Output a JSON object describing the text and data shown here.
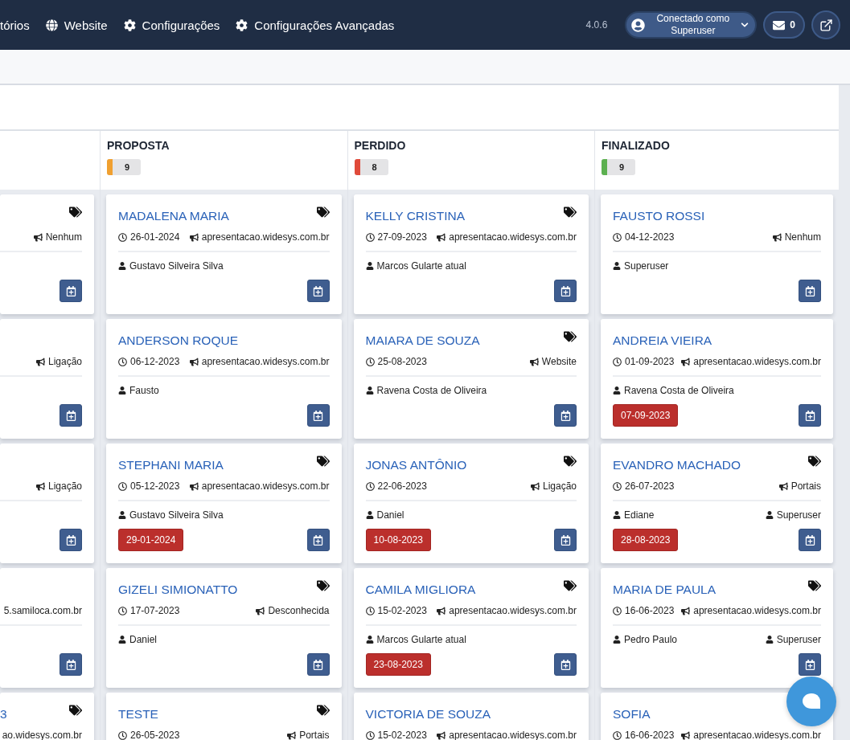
{
  "navbar": {
    "items": [
      {
        "label": "tórios"
      },
      {
        "label": "Website"
      },
      {
        "label": "Configurações"
      },
      {
        "label": "Configurações Avançadas"
      }
    ],
    "version": "4.0.6",
    "user": {
      "line1": "Conectado como",
      "line2": "Superuser"
    },
    "messages": "0"
  },
  "columns": [
    {
      "partial": true,
      "cards": [
        {
          "tagged": true,
          "source": "Nenhum",
          "cut": false
        },
        {
          "tagged": false,
          "source": "Ligação",
          "cut": false
        },
        {
          "tagged": false,
          "source": "Ligação",
          "cut": false
        },
        {
          "tagged": false,
          "source": "5.samiloca.com.br",
          "cut": true
        },
        {
          "tagged": true,
          "name": "3",
          "source": "ao.widesys.com.br",
          "cut": true
        }
      ]
    },
    {
      "partial": false,
      "title": "PROPOSTA",
      "count": "9",
      "color": "#f0a030",
      "cards": [
        {
          "name": "MADALENA MARIA",
          "tagged": true,
          "date": "26-01-2024",
          "source": "apresentacao.widesys.com.br",
          "owner": "Gustavo Silveira Silva"
        },
        {
          "name": "ANDERSON ROQUE",
          "tagged": false,
          "date": "06-12-2023",
          "source": "apresentacao.widesys.com.br",
          "owner": "Fausto"
        },
        {
          "name": "STEPHANI MARIA",
          "tagged": true,
          "date": "05-12-2023",
          "source": "apresentacao.widesys.com.br",
          "owner": "Gustavo Silveira Silva",
          "due": "29-01-2024"
        },
        {
          "name": "GIZELI SIMIONATTO",
          "tagged": true,
          "date": "17-07-2023",
          "source": "Desconhecida",
          "owner": "Daniel"
        },
        {
          "name": "TESTE",
          "tagged": true,
          "date": "26-05-2023",
          "source": "Portais"
        }
      ]
    },
    {
      "partial": false,
      "title": "PERDIDO",
      "count": "8",
      "color": "#e04a3a",
      "cards": [
        {
          "name": "KELLY CRISTINA",
          "tagged": true,
          "date": "27-09-2023",
          "source": "apresentacao.widesys.com.br",
          "owner": "Marcos Gularte atual"
        },
        {
          "name": "MAIARA DE SOUZA",
          "tagged": true,
          "date": "25-08-2023",
          "source": "Website",
          "owner": "Ravena Costa de Oliveira"
        },
        {
          "name": "JONAS ANTÔNIO",
          "tagged": true,
          "date": "22-06-2023",
          "source": "Ligação",
          "owner": "Daniel",
          "due": "10-08-2023"
        },
        {
          "name": "CAMILA MIGLIORA",
          "tagged": true,
          "date": "15-02-2023",
          "source": "apresentacao.widesys.com.br",
          "owner": "Marcos Gularte atual",
          "due": "23-08-2023"
        },
        {
          "name": "VICTORIA DE SOUZA",
          "tagged": false,
          "date": "15-02-2023",
          "source": "apresentacao.widesys.com.br"
        }
      ]
    },
    {
      "partial": false,
      "title": "FINALIZADO",
      "count": "9",
      "color": "#5cb050",
      "cards": [
        {
          "name": "FAUSTO ROSSI",
          "tagged": false,
          "date": "04-12-2023",
          "source": "Nenhum",
          "owner": "Superuser"
        },
        {
          "name": "ANDREIA VIEIRA",
          "tagged": false,
          "date": "01-09-2023",
          "source": "apresentacao.widesys.com.br",
          "owner": "Ravena Costa de Oliveira",
          "due": "07-09-2023"
        },
        {
          "name": "EVANDRO MACHADO",
          "tagged": true,
          "date": "26-07-2023",
          "source": "Portais",
          "owner": "Ediane",
          "assignee": "Superuser",
          "due": "28-08-2023"
        },
        {
          "name": "MARIA DE PAULA",
          "tagged": true,
          "date": "16-06-2023",
          "source": "apresentacao.widesys.com.br",
          "owner": "Pedro Paulo",
          "assignee": "Superuser"
        },
        {
          "name": "SOFIA",
          "tagged": false,
          "date": "16-06-2023",
          "source": "apresentacao.widesys.com.br"
        }
      ]
    }
  ]
}
